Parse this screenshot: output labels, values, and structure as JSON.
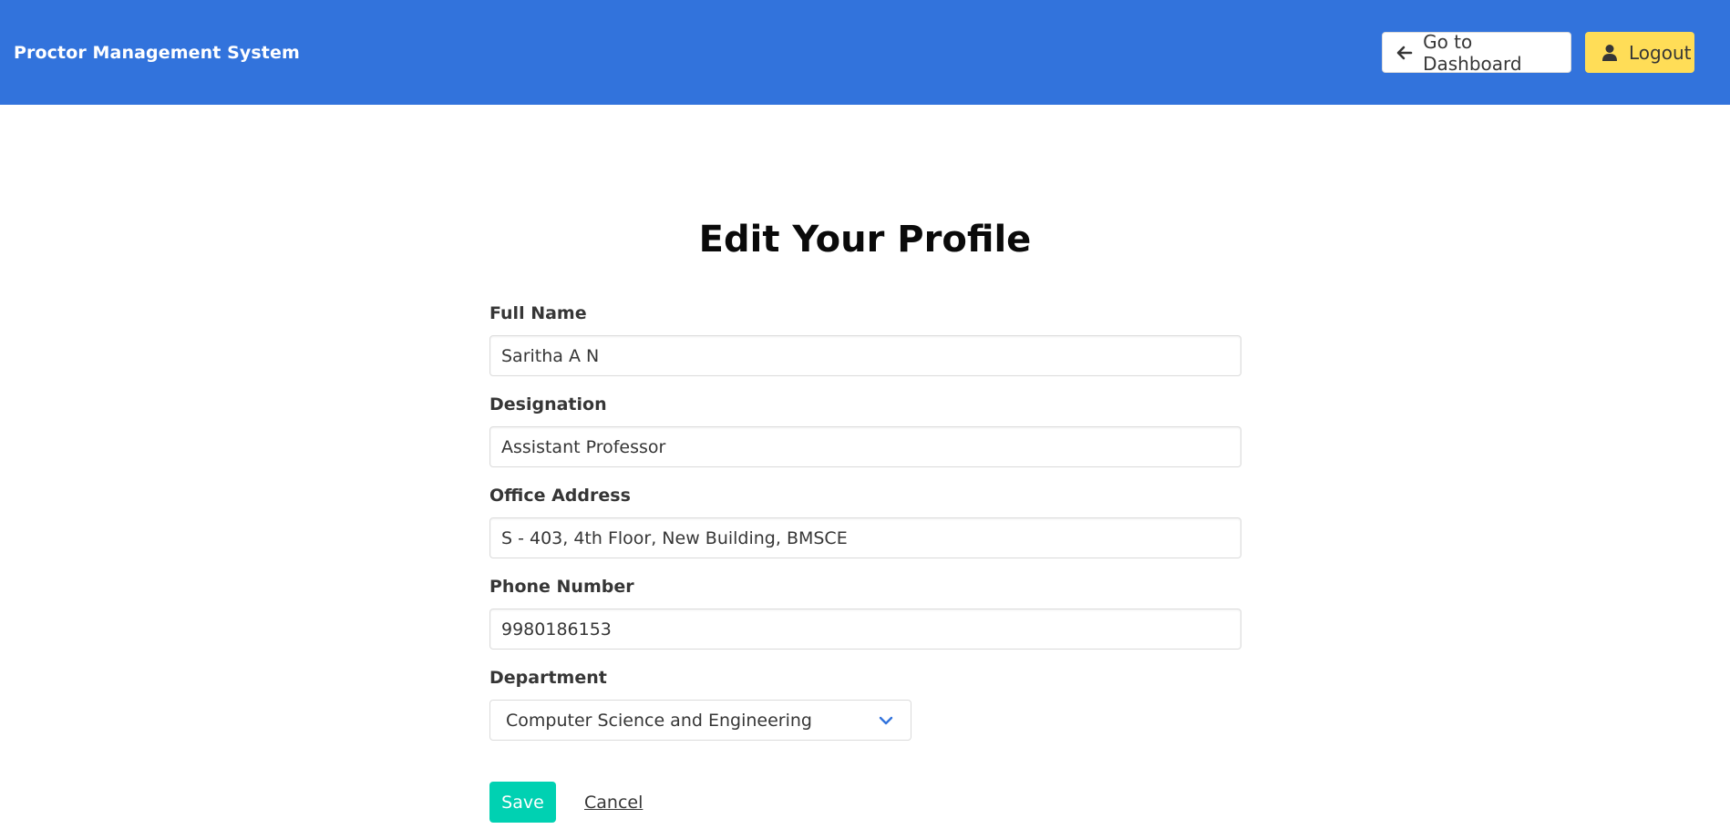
{
  "header": {
    "brand": "Proctor Management System",
    "dashboard_label": "Go to Dashboard",
    "logout_label": "Logout",
    "colors": {
      "navbar": "#3273dc",
      "logout": "#ffdd57"
    },
    "icons": {
      "dashboard": "arrow-left-icon",
      "logout": "user-icon"
    }
  },
  "form": {
    "title": "Edit Your Profile",
    "fields": [
      {
        "label": "Full Name",
        "value": "Saritha A N"
      },
      {
        "label": "Designation",
        "value": "Assistant Professor"
      },
      {
        "label": "Office Address",
        "value": "S - 403, 4th Floor, New Building, BMSCE"
      },
      {
        "label": "Phone Number",
        "value": "9980186153"
      }
    ],
    "department": {
      "label": "Department",
      "selected": "Computer Science and Engineering",
      "icon": "chevron-down-icon"
    },
    "save_label": "Save",
    "cancel_label": "Cancel",
    "save_color": "#00d1b2"
  }
}
